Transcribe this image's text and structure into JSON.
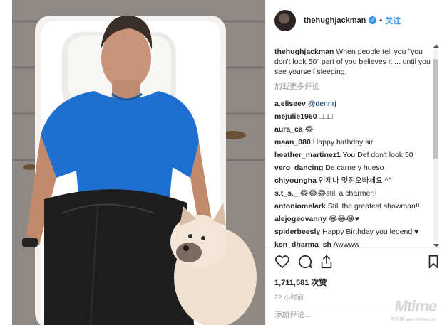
{
  "post": {
    "author": "thehughjackman",
    "verified_mark": "✓",
    "separator": "•",
    "follow_label": "关注"
  },
  "caption": {
    "author": "thehughjackman",
    "text": "When people tell you \"you don't look 50\" part of you believes it ... until you see yourself sleeping."
  },
  "load_more_label": "加载更多评论",
  "comments": [
    {
      "user": "a.eliseev",
      "text": "@dennrj"
    },
    {
      "user": "mejulie1960",
      "text": "□□□"
    },
    {
      "user": "aura_ca",
      "text": "😂"
    },
    {
      "user": "maan_080",
      "text": "Happy birthday sir"
    },
    {
      "user": "heather_martinez1",
      "text": "You Def don't look 50"
    },
    {
      "user": "vero_dancing",
      "text": "De carne y hueso"
    },
    {
      "user": "chiyoungha",
      "text": "언제나 멋진오빠세요 ^^"
    },
    {
      "user": "s.t_s._",
      "text": "😂😂😂still a charmer!!"
    },
    {
      "user": "antoniomelark",
      "text": "Still the greatest showman!!"
    },
    {
      "user": "alejogeovanny",
      "text": "😂😂😂♥"
    },
    {
      "user": "spiderbeesly",
      "text": "Happy Birthday you legend!♥"
    },
    {
      "user": "ken_dharma_sh",
      "text": "Awwww"
    }
  ],
  "scroll_position": 0.1,
  "actions": {
    "like_icon": "heart-icon",
    "comment_icon": "comment-bubble-icon",
    "share_icon": "share-icon",
    "save_icon": "bookmark-icon"
  },
  "likes_text": "1,711,581 次赞",
  "time_text": "22 小时前",
  "add_comment_placeholder": "添加评论...",
  "watermark": {
    "main": "Mtime",
    "sub": "时光网 www.mtime.com"
  },
  "colors": {
    "link_blue": "#3897f0",
    "text": "#262626",
    "muted": "#999999",
    "shirt_blue": "#1f6fd0"
  }
}
